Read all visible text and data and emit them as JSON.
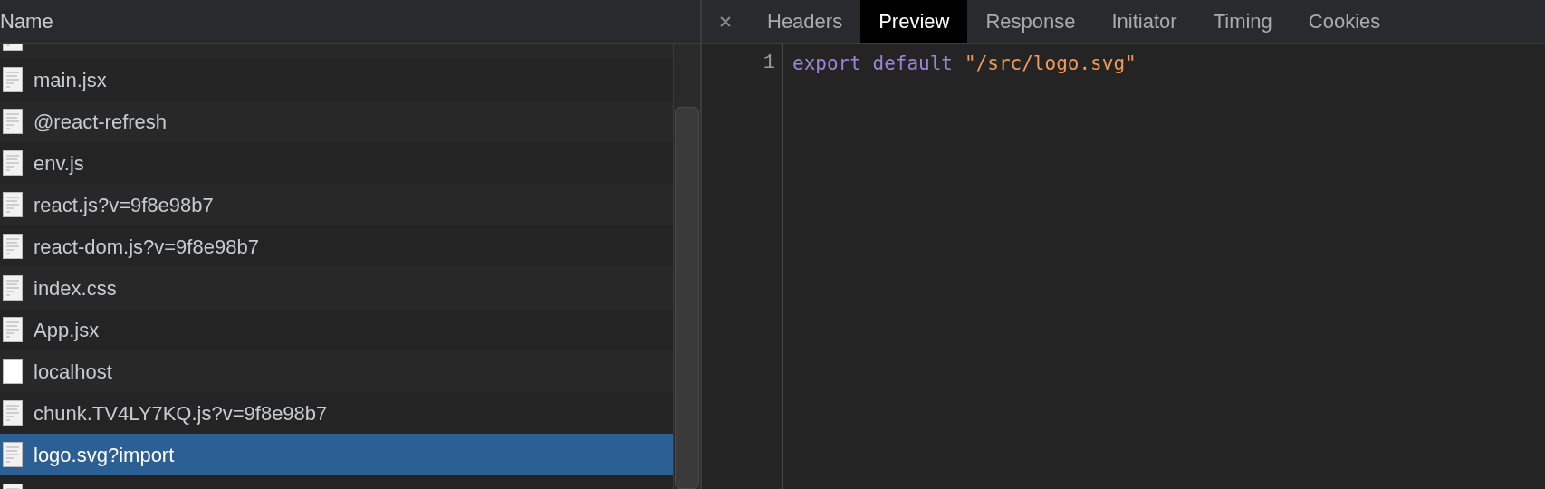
{
  "requests_panel": {
    "column_header": "Name",
    "rows": [
      {
        "kind": "script",
        "selected": false
      },
      {
        "name": "main.jsx",
        "kind": "script",
        "selected": false
      },
      {
        "name": "@react-refresh",
        "kind": "script",
        "selected": false
      },
      {
        "name": "env.js",
        "kind": "script",
        "selected": false
      },
      {
        "name": "react.js?v=9f8e98b7",
        "kind": "script",
        "selected": false
      },
      {
        "name": "react-dom.js?v=9f8e98b7",
        "kind": "script",
        "selected": false
      },
      {
        "name": "index.css",
        "kind": "script",
        "selected": false
      },
      {
        "name": "App.jsx",
        "kind": "script",
        "selected": false
      },
      {
        "name": "localhost",
        "kind": "document",
        "selected": false
      },
      {
        "name": "chunk.TV4LY7KQ.js?v=9f8e98b7",
        "kind": "script",
        "selected": false
      },
      {
        "name": "logo.svg?import",
        "kind": "script",
        "selected": true
      },
      {
        "kind": "script",
        "selected": false
      }
    ]
  },
  "detail_panel": {
    "tabs": [
      {
        "label": "Headers",
        "selected": false
      },
      {
        "label": "Preview",
        "selected": true
      },
      {
        "label": "Response",
        "selected": false
      },
      {
        "label": "Initiator",
        "selected": false
      },
      {
        "label": "Timing",
        "selected": false
      },
      {
        "label": "Cookies",
        "selected": false
      }
    ],
    "code_lines": [
      {
        "number": "1",
        "tokens": [
          {
            "kind": "keyword",
            "text": "export default"
          },
          {
            "kind": "string",
            "text": "\"/src/logo.svg\""
          }
        ]
      }
    ]
  }
}
